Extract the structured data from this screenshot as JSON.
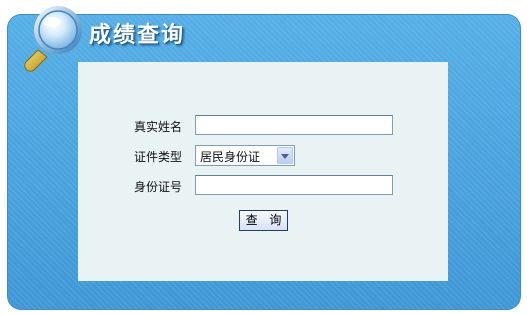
{
  "header": {
    "title": "成绩查询",
    "icon": "magnifier-icon"
  },
  "form": {
    "name_label": "真实姓名",
    "name_value": "",
    "id_type_label": "证件类型",
    "id_type_selected": "居民身份证",
    "id_number_label": "身份证号",
    "id_number_value": "",
    "submit_label": "查 询"
  },
  "colors": {
    "panel": "#4aa3dd",
    "form_background": "#e9f3f4",
    "title_text": "#ffffff",
    "button_border": "#1c3f73"
  }
}
